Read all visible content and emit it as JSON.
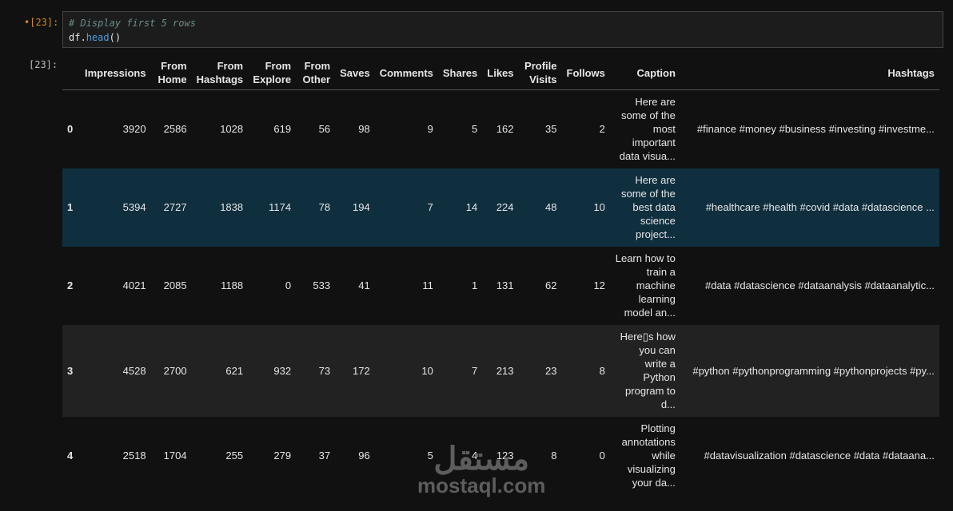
{
  "cell": {
    "in_prompt": "•[23]:",
    "out_prompt": "[23]:",
    "comment": "# Display first 5 rows",
    "code_obj": "df.",
    "code_fn": "head",
    "code_paren": "()"
  },
  "columns": [
    "",
    "Impressions",
    "From Home",
    "From Hashtags",
    "From Explore",
    "From Other",
    "Saves",
    "Comments",
    "Shares",
    "Likes",
    "Profile Visits",
    "Follows",
    "Caption",
    "Hashtags"
  ],
  "rows": [
    [
      "0",
      "3920",
      "2586",
      "1028",
      "619",
      "56",
      "98",
      "9",
      "5",
      "162",
      "35",
      "2",
      "Here are some of the most important data visua...",
      "#finance #money #business #investing #investme..."
    ],
    [
      "1",
      "5394",
      "2727",
      "1838",
      "1174",
      "78",
      "194",
      "7",
      "14",
      "224",
      "48",
      "10",
      "Here are some of the best data science project...",
      "#healthcare #health #covid #data #datascience ..."
    ],
    [
      "2",
      "4021",
      "2085",
      "1188",
      "0",
      "533",
      "41",
      "11",
      "1",
      "131",
      "62",
      "12",
      "Learn how to train a machine learning model an...",
      "#data #datascience #dataanalysis #dataanalytic..."
    ],
    [
      "3",
      "4528",
      "2700",
      "621",
      "932",
      "73",
      "172",
      "10",
      "7",
      "213",
      "23",
      "8",
      "Here▯s how you can write a Python program to d...",
      "#python #pythonprogramming #pythonprojects #py..."
    ],
    [
      "4",
      "2518",
      "1704",
      "255",
      "279",
      "37",
      "96",
      "5",
      "4",
      "123",
      "8",
      "0",
      "Plotting annotations while visualizing your da...",
      "#datavisualization #datascience #data #dataana..."
    ]
  ],
  "watermark": {
    "arabic": "مستقل",
    "latin": "mostaql.com"
  }
}
